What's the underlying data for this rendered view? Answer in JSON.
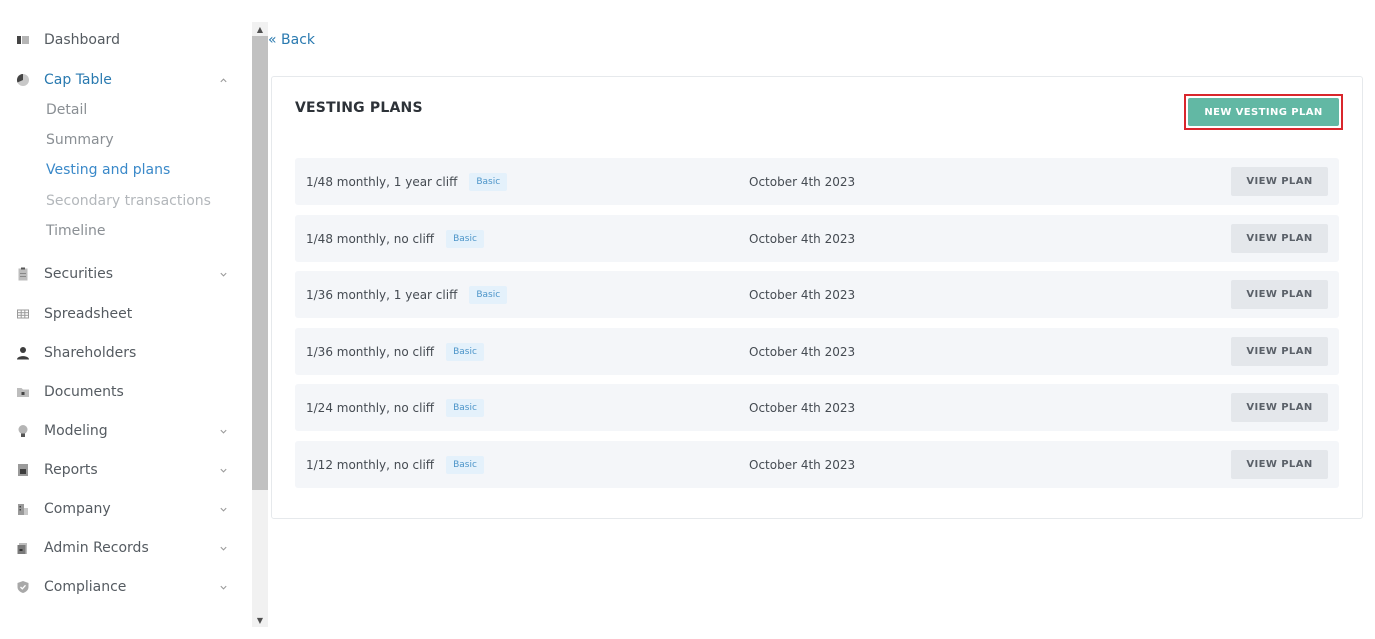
{
  "nav": {
    "dashboard": "Dashboard",
    "cap_table": "Cap Table",
    "cap_table_sub": {
      "detail": "Detail",
      "summary": "Summary",
      "vesting": "Vesting and plans",
      "secondary": "Secondary transactions",
      "timeline": "Timeline"
    },
    "securities": "Securities",
    "spreadsheet": "Spreadsheet",
    "shareholders": "Shareholders",
    "documents": "Documents",
    "modeling": "Modeling",
    "reports": "Reports",
    "company": "Company",
    "admin_records": "Admin Records",
    "compliance": "Compliance"
  },
  "back": "« Back",
  "card": {
    "title": "VESTING PLANS",
    "new_button": "NEW VESTING PLAN"
  },
  "plans": [
    {
      "name": "1/48 monthly, 1 year cliff",
      "badge": "Basic",
      "date": "October 4th 2023",
      "action": "VIEW PLAN"
    },
    {
      "name": "1/48 monthly, no cliff",
      "badge": "Basic",
      "date": "October 4th 2023",
      "action": "VIEW PLAN"
    },
    {
      "name": "1/36 monthly, 1 year cliff",
      "badge": "Basic",
      "date": "October 4th 2023",
      "action": "VIEW PLAN"
    },
    {
      "name": "1/36 monthly, no cliff",
      "badge": "Basic",
      "date": "October 4th 2023",
      "action": "VIEW PLAN"
    },
    {
      "name": "1/24 monthly, no cliff",
      "badge": "Basic",
      "date": "October 4th 2023",
      "action": "VIEW PLAN"
    },
    {
      "name": "1/12 monthly, no cliff",
      "badge": "Basic",
      "date": "October 4th 2023",
      "action": "VIEW PLAN"
    }
  ],
  "colors": {
    "accent": "#2a7ab0",
    "primary_button": "#62b8a4",
    "highlight_outline": "#d9262c",
    "row_bg": "#f4f6f9",
    "badge_bg": "#e4f1fb"
  }
}
